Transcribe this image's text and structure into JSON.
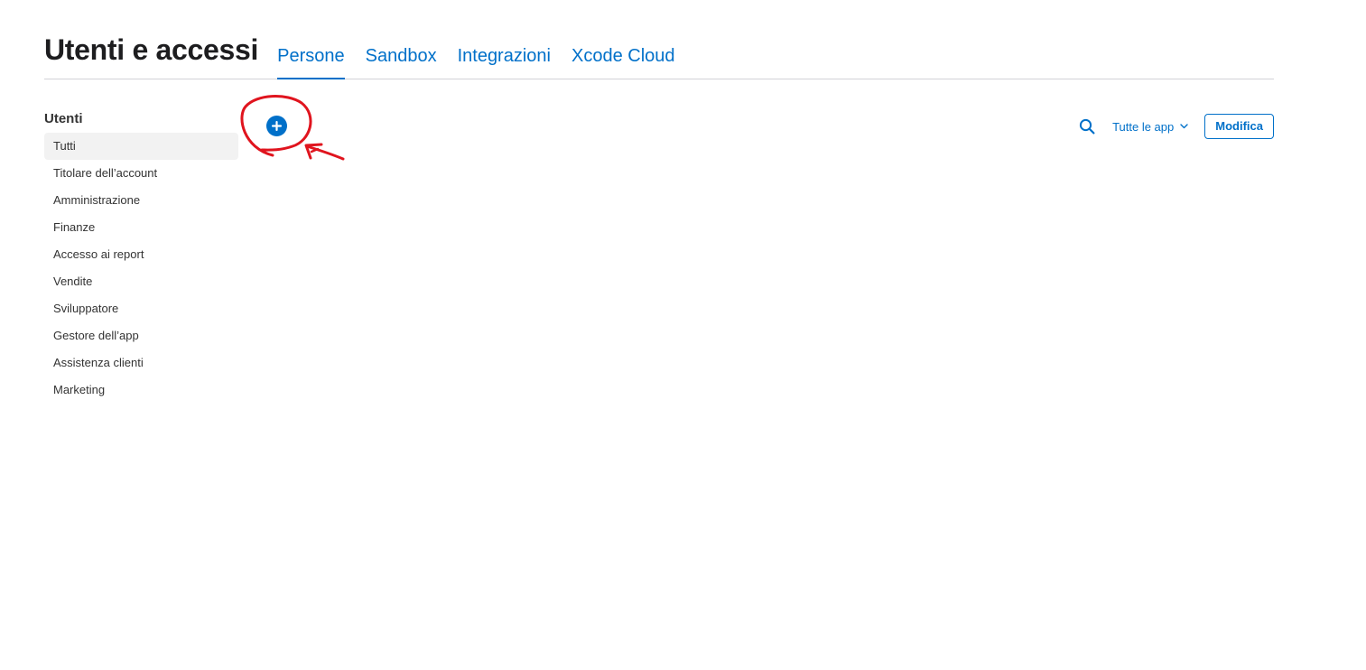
{
  "header": {
    "title": "Utenti e accessi",
    "tabs": [
      {
        "label": "Persone",
        "active": true
      },
      {
        "label": "Sandbox",
        "active": false
      },
      {
        "label": "Integrazioni",
        "active": false
      },
      {
        "label": "Xcode Cloud",
        "active": false
      }
    ]
  },
  "sidebar": {
    "heading": "Utenti",
    "items": [
      {
        "label": "Tutti",
        "active": true
      },
      {
        "label": "Titolare dell’account",
        "active": false
      },
      {
        "label": "Amministrazione",
        "active": false
      },
      {
        "label": "Finanze",
        "active": false
      },
      {
        "label": "Accesso ai report",
        "active": false
      },
      {
        "label": "Vendite",
        "active": false
      },
      {
        "label": "Sviluppatore",
        "active": false
      },
      {
        "label": "Gestore dell’app",
        "active": false
      },
      {
        "label": "Assistenza clienti",
        "active": false
      },
      {
        "label": "Marketing",
        "active": false
      }
    ]
  },
  "toolbar": {
    "add_icon": "plus-circle-icon",
    "search_icon": "search-icon",
    "app_filter_label": "Tutte le app",
    "app_filter_icon": "chevron-down-icon",
    "edit_label": "Modifica"
  },
  "annotation": {
    "description_icon": "red-circle-arrow-annotation",
    "color": "#e0141e"
  },
  "colors": {
    "accent": "#0070c9",
    "text": "#1d1d1f",
    "sidebar_text": "#333333",
    "active_bg": "#f2f2f2",
    "divider": "#d2d2d7"
  }
}
